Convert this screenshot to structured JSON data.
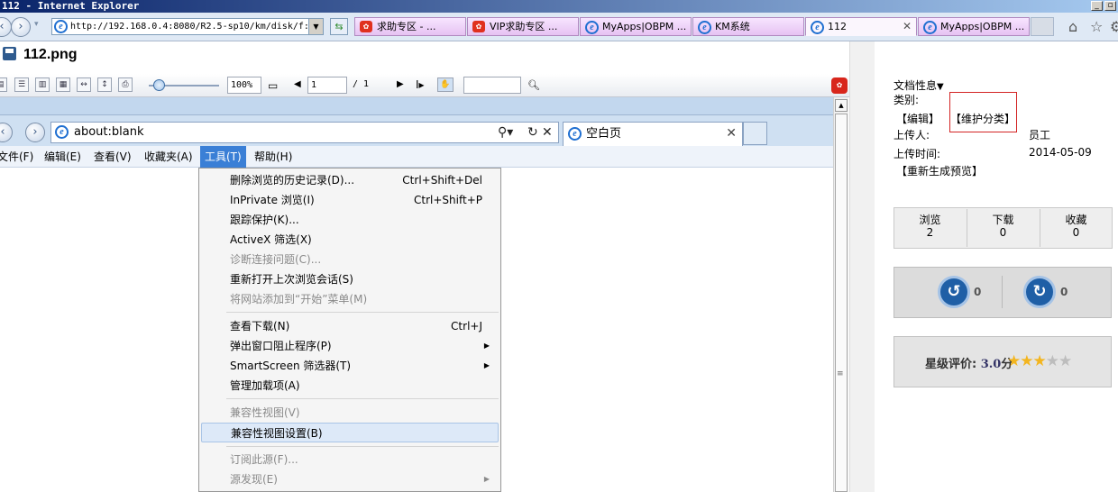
{
  "window": {
    "title": "112 - Internet Explorer"
  },
  "browser": {
    "address": "http://192.168.0.4:8080/R2.5-sp10/km/disk/f:",
    "tabs": [
      {
        "label": "求助专区 - ...",
        "icon": "red-logo-icon"
      },
      {
        "label": "VIP求助专区 ...",
        "icon": "red-logo-icon"
      },
      {
        "label": "MyApps|OBPM ...",
        "icon": "ie-icon"
      },
      {
        "label": "KM系统",
        "icon": "ie-icon"
      },
      {
        "label": "112",
        "icon": "ie-icon",
        "active": true
      },
      {
        "label": "MyApps|OBPM ...",
        "icon": "ie-icon"
      }
    ]
  },
  "document": {
    "title": "112.png"
  },
  "viewer": {
    "zoom": "100%",
    "page_current": "1",
    "page_total": "/ 1",
    "search_value": ""
  },
  "embedded": {
    "address": "about:blank",
    "tab_label": "空白页",
    "menu": [
      "文件(F)",
      "编辑(E)",
      "查看(V)",
      "收藏夹(A)",
      "工具(T)",
      "帮助(H)"
    ],
    "dropdown": [
      {
        "label": "删除浏览的历史记录(D)...",
        "shortcut": "Ctrl+Shift+Del"
      },
      {
        "label": "InPrivate 浏览(I)",
        "shortcut": "Ctrl+Shift+P"
      },
      {
        "label": "跟踪保护(K)..."
      },
      {
        "label": "ActiveX 筛选(X)"
      },
      {
        "label": "诊断连接问题(C)...",
        "disabled": true
      },
      {
        "label": "重新打开上次浏览会话(S)"
      },
      {
        "label": "将网站添加到“开始”菜单(M)",
        "disabled": true
      },
      {
        "label": "查看下载(N)",
        "shortcut": "Ctrl+J"
      },
      {
        "label": "弹出窗口阻止程序(P)",
        "submenu": true
      },
      {
        "label": "SmartScreen 筛选器(T)",
        "submenu": true
      },
      {
        "label": "管理加载项(A)"
      },
      {
        "label": "兼容性视图(V)",
        "disabled": true
      },
      {
        "label": "兼容性视图设置(B)",
        "highlighted": true
      },
      {
        "label": "订阅此源(F)...",
        "disabled": true
      },
      {
        "label": "源发现(E)",
        "disabled": true,
        "submenu": true
      }
    ]
  },
  "sidebar": {
    "doc_props_label": "文档性息",
    "category_label": "类别:",
    "edit_link": "【编辑】",
    "maintain_link": "【维护分类】",
    "uploader_label": "上传人:",
    "uploader_value": "员工",
    "upload_time_label": "上传时间:",
    "upload_time_value": "2014-05-09",
    "regen_link": "【重新生成预览】",
    "stats": [
      {
        "label": "浏览",
        "value": "2"
      },
      {
        "label": "下载",
        "value": "0"
      },
      {
        "label": "收藏",
        "value": "0"
      }
    ],
    "vote_up_count": "0",
    "vote_down_count": "0",
    "rating_label": "星级评价:",
    "rating_value": "3.0",
    "rating_unit": "分",
    "rating_stars": 3,
    "rating_max": 5
  }
}
